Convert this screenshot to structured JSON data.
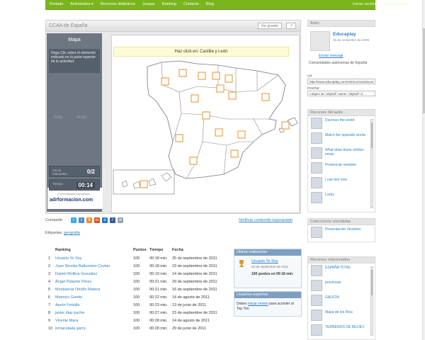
{
  "topbar": {
    "nav": [
      "Portada",
      "Actividades ▾",
      "Recursos didácticos",
      "Juegos",
      "Ranking",
      "Contacto",
      "Blog"
    ],
    "right": [
      "Iniciar sesión",
      "Mi educaplay"
    ]
  },
  "activity": {
    "title": "CCAA de España",
    "grande_label": "Ver grande",
    "share_label": "↗",
    "mapa_label": "Mapa",
    "instruction": "Haga Clic sobre el elemento indicado en la parte superior de la actividad.",
    "amp_labels": [
      "Amp.",
      "Ampl."
    ],
    "stats": [
      {
        "label": "Veces intentadas",
        "value": "0/2"
      },
      {
        "label": "Puntos",
        "value": "0"
      },
      {
        "label": "Tiempo",
        "value": "00:14"
      }
    ],
    "logo_small": "Comunidades Actividades",
    "logo_text": "adrformacion.com",
    "prompt": "Haz click en: Castilla y León"
  },
  "compartir": {
    "label": "Compartir:",
    "icons": [
      "twitter-icon",
      "tuenti-icon",
      "blogger-icon",
      "meneame-icon",
      "delicious-icon",
      "facebook-icon",
      "email-icon"
    ],
    "report": "Notificar contenido inapropiado"
  },
  "tags": {
    "label": "Etiquetas:",
    "tag": "geografia"
  },
  "ranking": {
    "headers": [
      "Ranking",
      "Puntos",
      "Tiempo",
      "Fecha"
    ],
    "rows": [
      [
        "1",
        "Usuario Yo Soy",
        "100",
        "00:18 min.",
        "25 de septiembre de 2011"
      ],
      [
        "2",
        "Juan Nicolás Balbuvieto Ceylan",
        "100",
        "00:18 min.",
        "23 de septiembre de 2011"
      ],
      [
        "3",
        "Daniel Mollina González",
        "100",
        "00:19 min.",
        "14 de septiembre de 2011"
      ],
      [
        "4",
        "Ángel Palazón Pérez",
        "100",
        "00:21 min.",
        "29 de septiembre de 2011"
      ],
      [
        "5",
        "Montserrat Ortúño Matera",
        "100",
        "00:21 min.",
        "16 de septiembre de 2011"
      ],
      [
        "6",
        "Mamoru Gondo",
        "100",
        "00:22 min.",
        "14 de agosto de 2011"
      ],
      [
        "7",
        "Aarón Fertullo",
        "100",
        "00:23 min.",
        "13 de junio de 2011"
      ],
      [
        "8",
        "javier diaz pache",
        "100",
        "00:27 min.",
        "23 de septiembre de 2011"
      ],
      [
        "9",
        "Vicente Mara",
        "100",
        "00:28 min.",
        "14 de agosto de 2011"
      ],
      [
        "10",
        "inmaculada garcy",
        "100",
        "00:28 min.",
        "29 de junio de 2011"
      ]
    ]
  },
  "last_result": {
    "title": "Última realización",
    "user": "Usuario Yo Soy",
    "date": "25 de septiembre de 2011",
    "points": "100 puntos en 00:18 min."
  },
  "topten": {
    "title": "Usuarios expertos",
    "text_before": "Debes",
    "link": "iniciar sesión",
    "text_after": "para acceder al Top Ten."
  },
  "sidebar": {
    "user_section": "Autor",
    "username": "Educaplay",
    "since": "25 de noviembre de 2008",
    "contact": "Enviar mensaje",
    "description": "Comunidades autónomas de España",
    "embed_labels": [
      "Url",
      "Insertar"
    ],
    "embed_values": [
      "http://www.educaplay.com/es/recursoseducat",
      "<object id=\"objSwf\" name=\"objSwf\" cl"
    ],
    "resources_title": "Recursos del autor",
    "resources": [
      "Discover the world",
      "Match the opposite words",
      "What does these clothes mean",
      "Pronunciar vestidos",
      "I can feel now",
      "Lucky"
    ],
    "collections_title": "Colecciones vinculadas",
    "collections": [
      "Presentación Vectebol"
    ],
    "related_title": "Recursos relacionados",
    "related": [
      "ESPAÑA TOTAL",
      "provincias",
      "GALICIA",
      "Mapa de los Ríos",
      "TERRENOS DE RELIEV"
    ]
  },
  "colors": {
    "green": "#7ab51d",
    "panel": "#6e7682",
    "link": "#2a7fc4",
    "marker": "#e8a34a"
  }
}
